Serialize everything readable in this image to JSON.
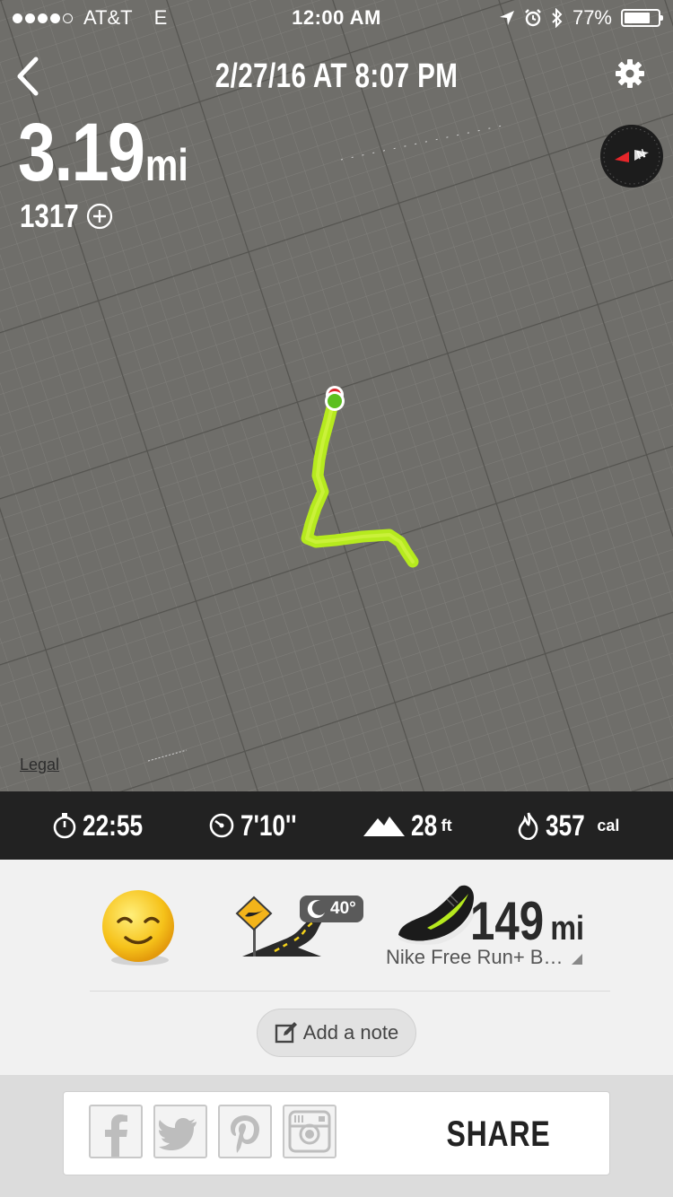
{
  "status_bar": {
    "carrier": "AT&T",
    "network": "E",
    "time": "12:00 AM",
    "battery": "77%",
    "battery_fraction": 0.77,
    "signal_bars_filled": 4,
    "icons": [
      "location-arrow-icon",
      "alarm-icon",
      "bluetooth-icon",
      "battery-icon"
    ]
  },
  "header": {
    "back_icon": "chevron-left-icon",
    "date_time": "2/27/16 AT 8:07 PM",
    "settings_icon": "gear-icon"
  },
  "run": {
    "distance": "3.19",
    "distance_unit": "mi",
    "fuel": "1317",
    "fuel_icon": "plus-circle-icon"
  },
  "map": {
    "legal_link": "Legal",
    "route_color": "#b6ea1e",
    "start_marker_color": "#5bbf1f",
    "end_marker_color": "#d9262a",
    "compass_icon": "compass-icon"
  },
  "stats": {
    "duration": "22:55",
    "pace": "7'10''",
    "elevation": "28",
    "elevation_unit": "ft",
    "calories": "357",
    "calories_unit": "cal",
    "icons": [
      "stopwatch-icon",
      "speedometer-icon",
      "mountain-icon",
      "flame-icon"
    ]
  },
  "details": {
    "mood_icon": "smiley-icon",
    "terrain_icon": "road-icon",
    "weather_icon": "moon-icon",
    "temperature": "40°",
    "shoe_miles": "149",
    "shoe_miles_unit": "mi",
    "shoe_name": "Nike Free Run+ B…",
    "add_note_label": "Add a note",
    "add_note_icon": "edit-note-icon"
  },
  "share": {
    "label": "SHARE",
    "services": [
      "facebook-icon",
      "twitter-icon",
      "pinterest-icon",
      "instagram-icon"
    ]
  },
  "colors": {
    "stats_bar_bg": "#222222",
    "nike_volt": "#b6ea1e"
  }
}
